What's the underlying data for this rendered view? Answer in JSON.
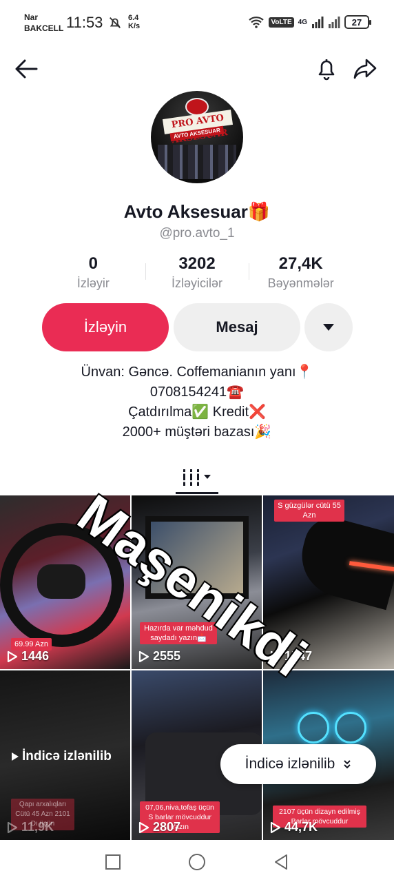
{
  "status": {
    "carrier_line1": "Nar",
    "carrier_line2": "BAKCELL",
    "time": "11:53",
    "net_speed_value": "6.4",
    "net_speed_unit": "K/s",
    "volte": "VoLTE",
    "network": "4G",
    "battery": "27"
  },
  "nav": {
    "back_icon": "arrow-left-icon",
    "bell_icon": "bell-icon",
    "share_icon": "share-icon"
  },
  "profile": {
    "name": "Avto Aksesuar🎁",
    "handle": "@pro.avto_1",
    "avatar_sign": "PRO AVTO AKSESUAR",
    "avatar_sub": "AVTO AKSESUAR"
  },
  "stats": [
    {
      "value": "0",
      "label": "İzləyir"
    },
    {
      "value": "3202",
      "label": "İzləyicilər"
    },
    {
      "value": "27,4K",
      "label": "Bəyənmələr"
    }
  ],
  "actions": {
    "follow": "İzləyin",
    "message": "Mesaj"
  },
  "bio": [
    "Ünvan: Gəncə. Coffemanianın yanı📍",
    "0708154241☎️",
    "Çatdırılma✅ Kredit❌",
    "2000+ müştəri bazası🎉"
  ],
  "videos": [
    {
      "tag": "69.99 Azn",
      "views": "1446"
    },
    {
      "tag": "Hazırda var məhdud saydadı yazın📩",
      "views": "2555"
    },
    {
      "tag": "S güzgülər cütü 55 Azn",
      "views": "1547"
    },
    {
      "label": "İndicə izlənilib",
      "tag": "Qapı arxalıqları Cütü 45 Azn 2101 Dı üçün",
      "views": "11,9K"
    },
    {
      "tag": "07,06,niva,tofaş üçün S barlar mövcuddur Yazın",
      "views": "2807"
    },
    {
      "tag": "2107 üçün dizayn edilmiş Barlar mövcuddur",
      "views": "44,7K"
    }
  ],
  "watermark": "Maşenikdi",
  "pill": "İndicə izlənilib"
}
